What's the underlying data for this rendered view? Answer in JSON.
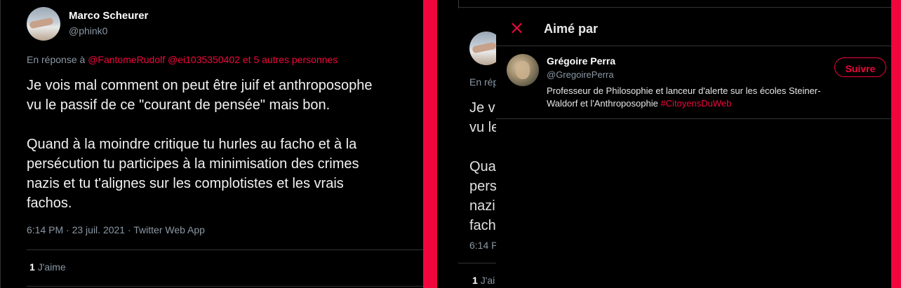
{
  "left_tweet": {
    "author_name": "Marco Scheurer",
    "author_handle": "@phink0",
    "reply_prefix": "En réponse à",
    "reply_mention_1": "@FantomeRudolf",
    "reply_mention_2": "@ei1035350402",
    "reply_others": "et 5 autres personnes",
    "body": "Je vois mal comment on peut être juif et anthroposophe\nvu le passif de ce \"courant de pensée\" mais bon.\n\nQuand à la moindre critique tu hurles au facho et à la\npersécution tu participes à la minimisation des crimes\nnazis et tu t'alignes sur les complotistes et les vrais\nfachos.",
    "timestamp": "6:14 PM · 23 juil. 2021 · Twitter Web App",
    "like_count": "1",
    "like_label": "J'aime"
  },
  "right_background": {
    "reply_fragment": "En rép",
    "body_fragment": "Je v\nvu le\n\nQua\npers\nnazi\nfach",
    "timestamp_fragment": "6:14 P",
    "like_count": "1",
    "like_label": "J'ai"
  },
  "modal": {
    "title": "Aimé par",
    "user": {
      "name": "Grégoire Perra",
      "handle": "@GregoirePerra",
      "follow_label": "Suivre",
      "bio_text": "Professeur de Philosophie et lanceur d'alerte sur les écoles Steiner-\nWaldorf et l'Anthroposophie ",
      "bio_hashtag": "#CitoyensDuWeb"
    }
  },
  "colors": {
    "accent": "#f0063d",
    "background": "#000000",
    "secondary_text": "#8b98a5",
    "divider": "#2f3336"
  },
  "icons": [
    "close-icon"
  ]
}
